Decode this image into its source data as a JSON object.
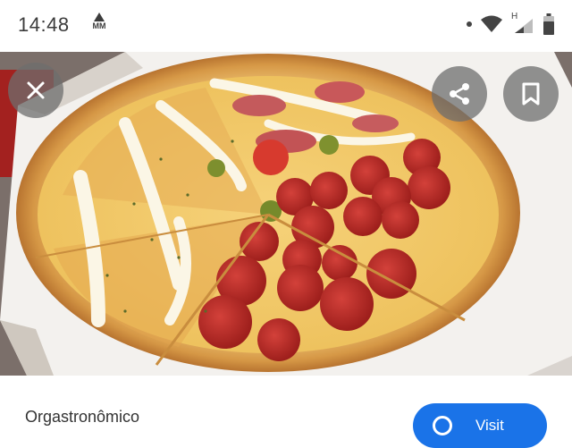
{
  "status_bar": {
    "time": "14:48",
    "notification_label": "MM",
    "network_label": "H"
  },
  "viewer": {
    "close_icon": "close-icon",
    "share_icon": "share-icon",
    "bookmark_icon": "bookmark-icon",
    "image_subject": "pizza"
  },
  "result": {
    "source_name": "Orgastronômico",
    "visit_label": "Visit"
  },
  "colors": {
    "accent": "#1a73e8",
    "overlay_button": "#6e6e6e",
    "status_text": "#3c3c3c"
  }
}
